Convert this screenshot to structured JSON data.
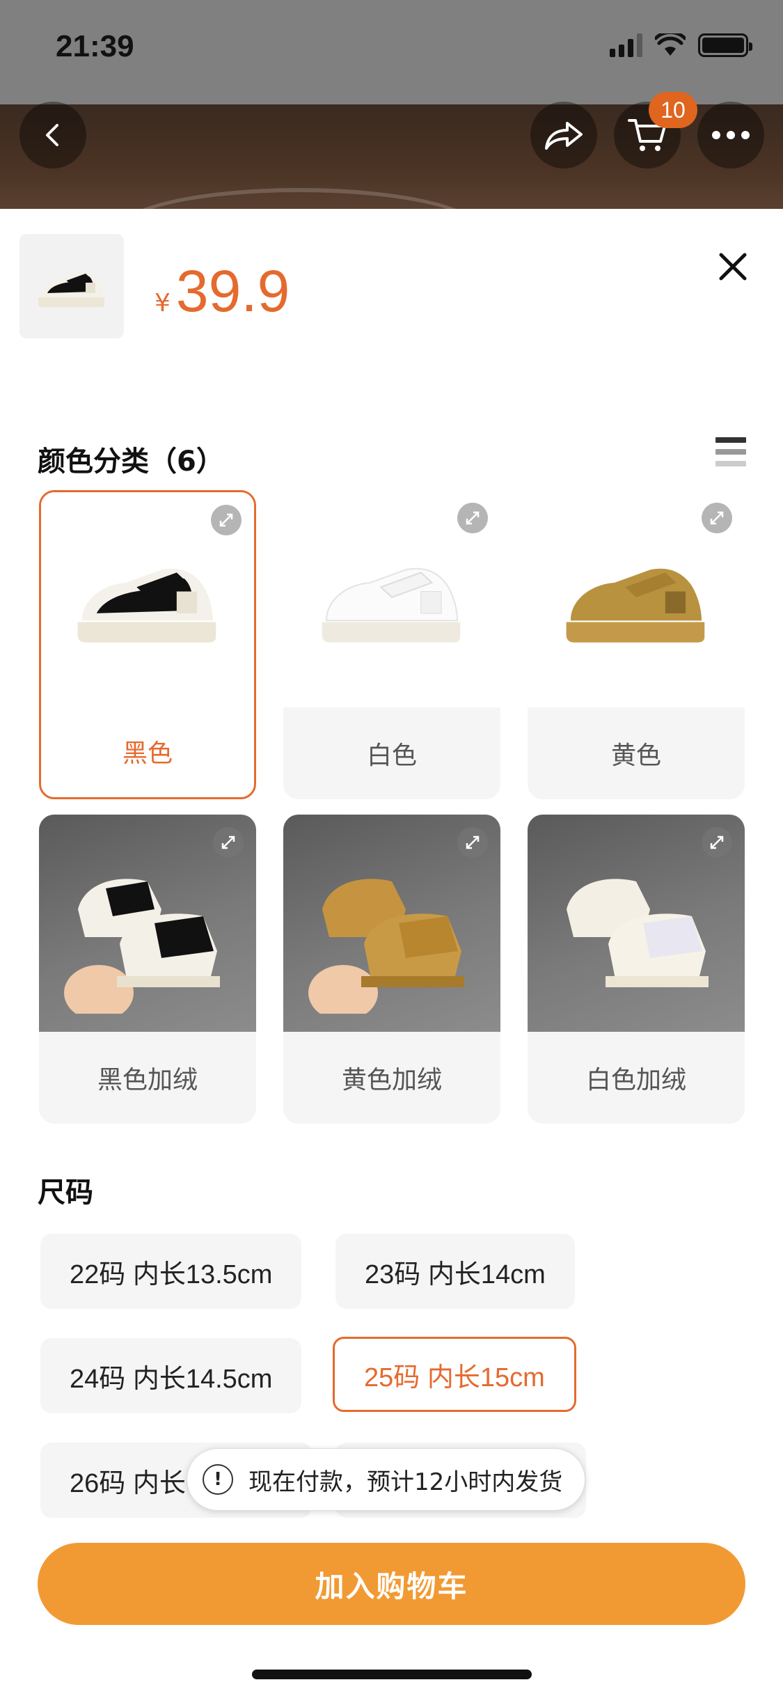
{
  "status_bar": {
    "time": "21:39"
  },
  "nav": {
    "cart_badge": "10"
  },
  "product": {
    "currency": "¥",
    "price": "39.9"
  },
  "colors_section": {
    "title": "颜色分类（6）",
    "items": [
      {
        "label": "黑色",
        "selected": true,
        "style": "plain"
      },
      {
        "label": "白色",
        "selected": false,
        "style": "plain"
      },
      {
        "label": "黄色",
        "selected": false,
        "style": "plain"
      },
      {
        "label": "黑色加绒",
        "selected": false,
        "style": "photo"
      },
      {
        "label": "黄色加绒",
        "selected": false,
        "style": "photo"
      },
      {
        "label": "白色加绒",
        "selected": false,
        "style": "photo"
      }
    ]
  },
  "size_section": {
    "title": "尺码",
    "options": [
      {
        "label": "22码 内长13.5cm",
        "selected": false
      },
      {
        "label": "23码 内长14cm",
        "selected": false
      },
      {
        "label": "24码 内长14.5cm",
        "selected": false
      },
      {
        "label": "25码 内长15cm",
        "selected": true
      },
      {
        "label": "26码 内长",
        "selected": false
      }
    ]
  },
  "toast": {
    "text": "现在付款，预计12小时内发货"
  },
  "footer": {
    "add_to_cart": "加入购物车"
  },
  "theme": {
    "accent": "#e56a2e",
    "button": "#f19a33"
  }
}
